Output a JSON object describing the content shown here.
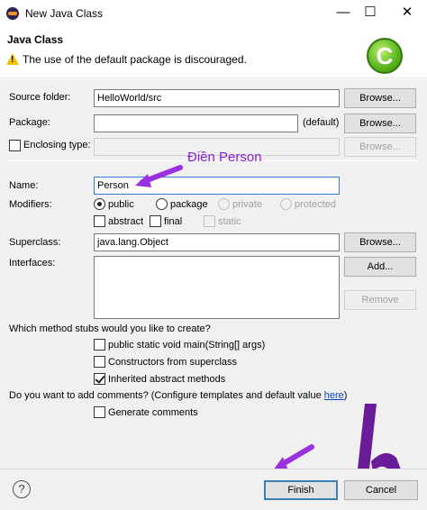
{
  "window": {
    "title": "New Java Class",
    "minimize": "—",
    "maximize": "☐",
    "close": "✕"
  },
  "header": {
    "title": "Java Class",
    "warning": "The use of the default package is discouraged."
  },
  "source_folder": {
    "label": "Source folder:",
    "value": "HelloWorld/src",
    "browse": "Browse..."
  },
  "package": {
    "label": "Package:",
    "value": "",
    "suffix": "(default)",
    "browse": "Browse..."
  },
  "enclosing_type": {
    "label": "Enclosing type:",
    "checked": false,
    "value": "",
    "browse": "Browse..."
  },
  "annotation": "Điền Person",
  "name": {
    "label": "Name:",
    "value": "Person"
  },
  "modifiers": {
    "label": "Modifiers:",
    "access": [
      {
        "label": "public",
        "selected": true,
        "enabled": true
      },
      {
        "label": "package",
        "selected": false,
        "enabled": true
      },
      {
        "label": "private",
        "selected": false,
        "enabled": false
      },
      {
        "label": "protected",
        "selected": false,
        "enabled": false
      }
    ],
    "flags": [
      {
        "label": "abstract",
        "checked": false,
        "enabled": true
      },
      {
        "label": "final",
        "checked": false,
        "enabled": true
      },
      {
        "label": "static",
        "checked": false,
        "enabled": false
      }
    ]
  },
  "superclass": {
    "label": "Superclass:",
    "value": "java.lang.Object",
    "browse": "Browse..."
  },
  "interfaces": {
    "label": "Interfaces:",
    "add": "Add...",
    "remove": "Remove"
  },
  "stubs": {
    "question": "Which method stubs would you like to create?",
    "options": [
      {
        "label": "public static void main(String[] args)",
        "checked": false
      },
      {
        "label": "Constructors from superclass",
        "checked": false
      },
      {
        "label": "Inherited abstract methods",
        "checked": true
      }
    ]
  },
  "comments": {
    "question": "Do you want to add comments? (Configure templates and default value ",
    "link": "here",
    "question_end": ")",
    "option": {
      "label": "Generate comments",
      "checked": false
    }
  },
  "footer": {
    "help": "?",
    "finish": "Finish",
    "cancel": "Cancel"
  },
  "colors": {
    "annotation": "#8a1fd6",
    "arrow": "#9b30e0",
    "logo": "#6a1b9a",
    "accent": "#3c7fb1"
  }
}
